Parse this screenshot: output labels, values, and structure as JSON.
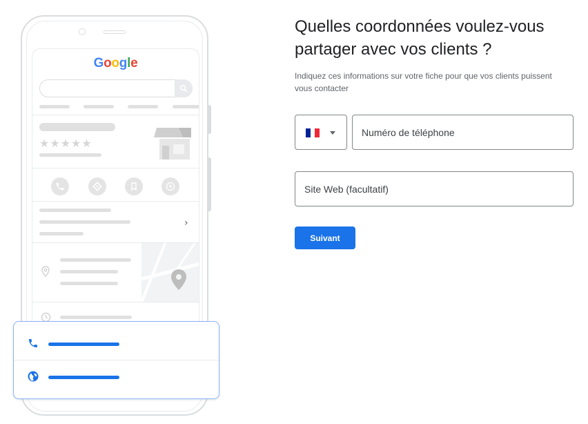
{
  "illustration": {
    "logo": {
      "letters": [
        {
          "char": "G",
          "color": "#4285F4"
        },
        {
          "char": "o",
          "color": "#EA4335"
        },
        {
          "char": "o",
          "color": "#FBBC05"
        },
        {
          "char": "g",
          "color": "#4285F4"
        },
        {
          "char": "l",
          "color": "#34A853"
        },
        {
          "char": "e",
          "color": "#EA4335"
        }
      ]
    },
    "rating_stars": "★★★★★",
    "chevron": "›",
    "action_icons": [
      "phone-icon",
      "directions-icon",
      "bookmark-icon",
      "website-icon"
    ],
    "contact_card_icons": [
      "phone-icon",
      "globe-icon"
    ],
    "accent_color": "#1a73e8"
  },
  "form": {
    "title": "Quelles coordonnées voulez-vous partager avec vos clients ?",
    "subtitle": "Indiquez ces informations sur votre fiche pour que vos clients puissent vous contacter",
    "country": {
      "flag_colors": [
        "#002395",
        "#ffffff",
        "#ED2939"
      ],
      "icon": "chevron-down-icon"
    },
    "phone_placeholder": "Numéro de téléphone",
    "website_placeholder": "Site Web (facultatif)",
    "next_label": "Suivant",
    "button_color": "#1a73e8"
  }
}
